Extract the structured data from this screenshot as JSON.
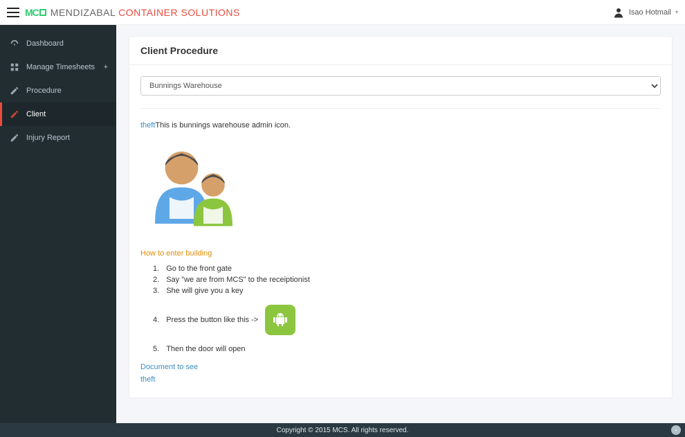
{
  "brand": {
    "glyph": "MCS",
    "name1": "MENDIZABAL",
    "name2": "CONTAINER SOLUTIONS"
  },
  "user": {
    "name": "Isao Hotmail"
  },
  "sidebar": {
    "items": [
      {
        "label": "Dashboard",
        "icon": "dashboard-icon",
        "active": false,
        "expandable": false
      },
      {
        "label": "Manage Timesheets",
        "icon": "grid-icon",
        "active": false,
        "expandable": true
      },
      {
        "label": "Procedure",
        "icon": "pencil-icon",
        "active": false,
        "expandable": false
      },
      {
        "label": "Client",
        "icon": "pencil-icon",
        "active": true,
        "expandable": false
      },
      {
        "label": "Injury Report",
        "icon": "pencil-icon",
        "active": false,
        "expandable": false
      }
    ]
  },
  "page": {
    "title": "Client Procedure",
    "selected_client": "Bunnings Warehouse"
  },
  "procedure": {
    "tag": "theft",
    "desc": "This is bunnings warehouse admin icon.",
    "howto_title": "How to enter building",
    "steps": [
      "Go to the front gate",
      "Say \"we are from MCS\" to the receiptionist",
      "She will give you a key",
      "Press the button like this ->",
      "Then the door will open"
    ],
    "doc_label": "Document to see",
    "end_tag": "theft"
  },
  "footer": {
    "text": "Copyright © 2015 MCS. All rights reserved."
  }
}
